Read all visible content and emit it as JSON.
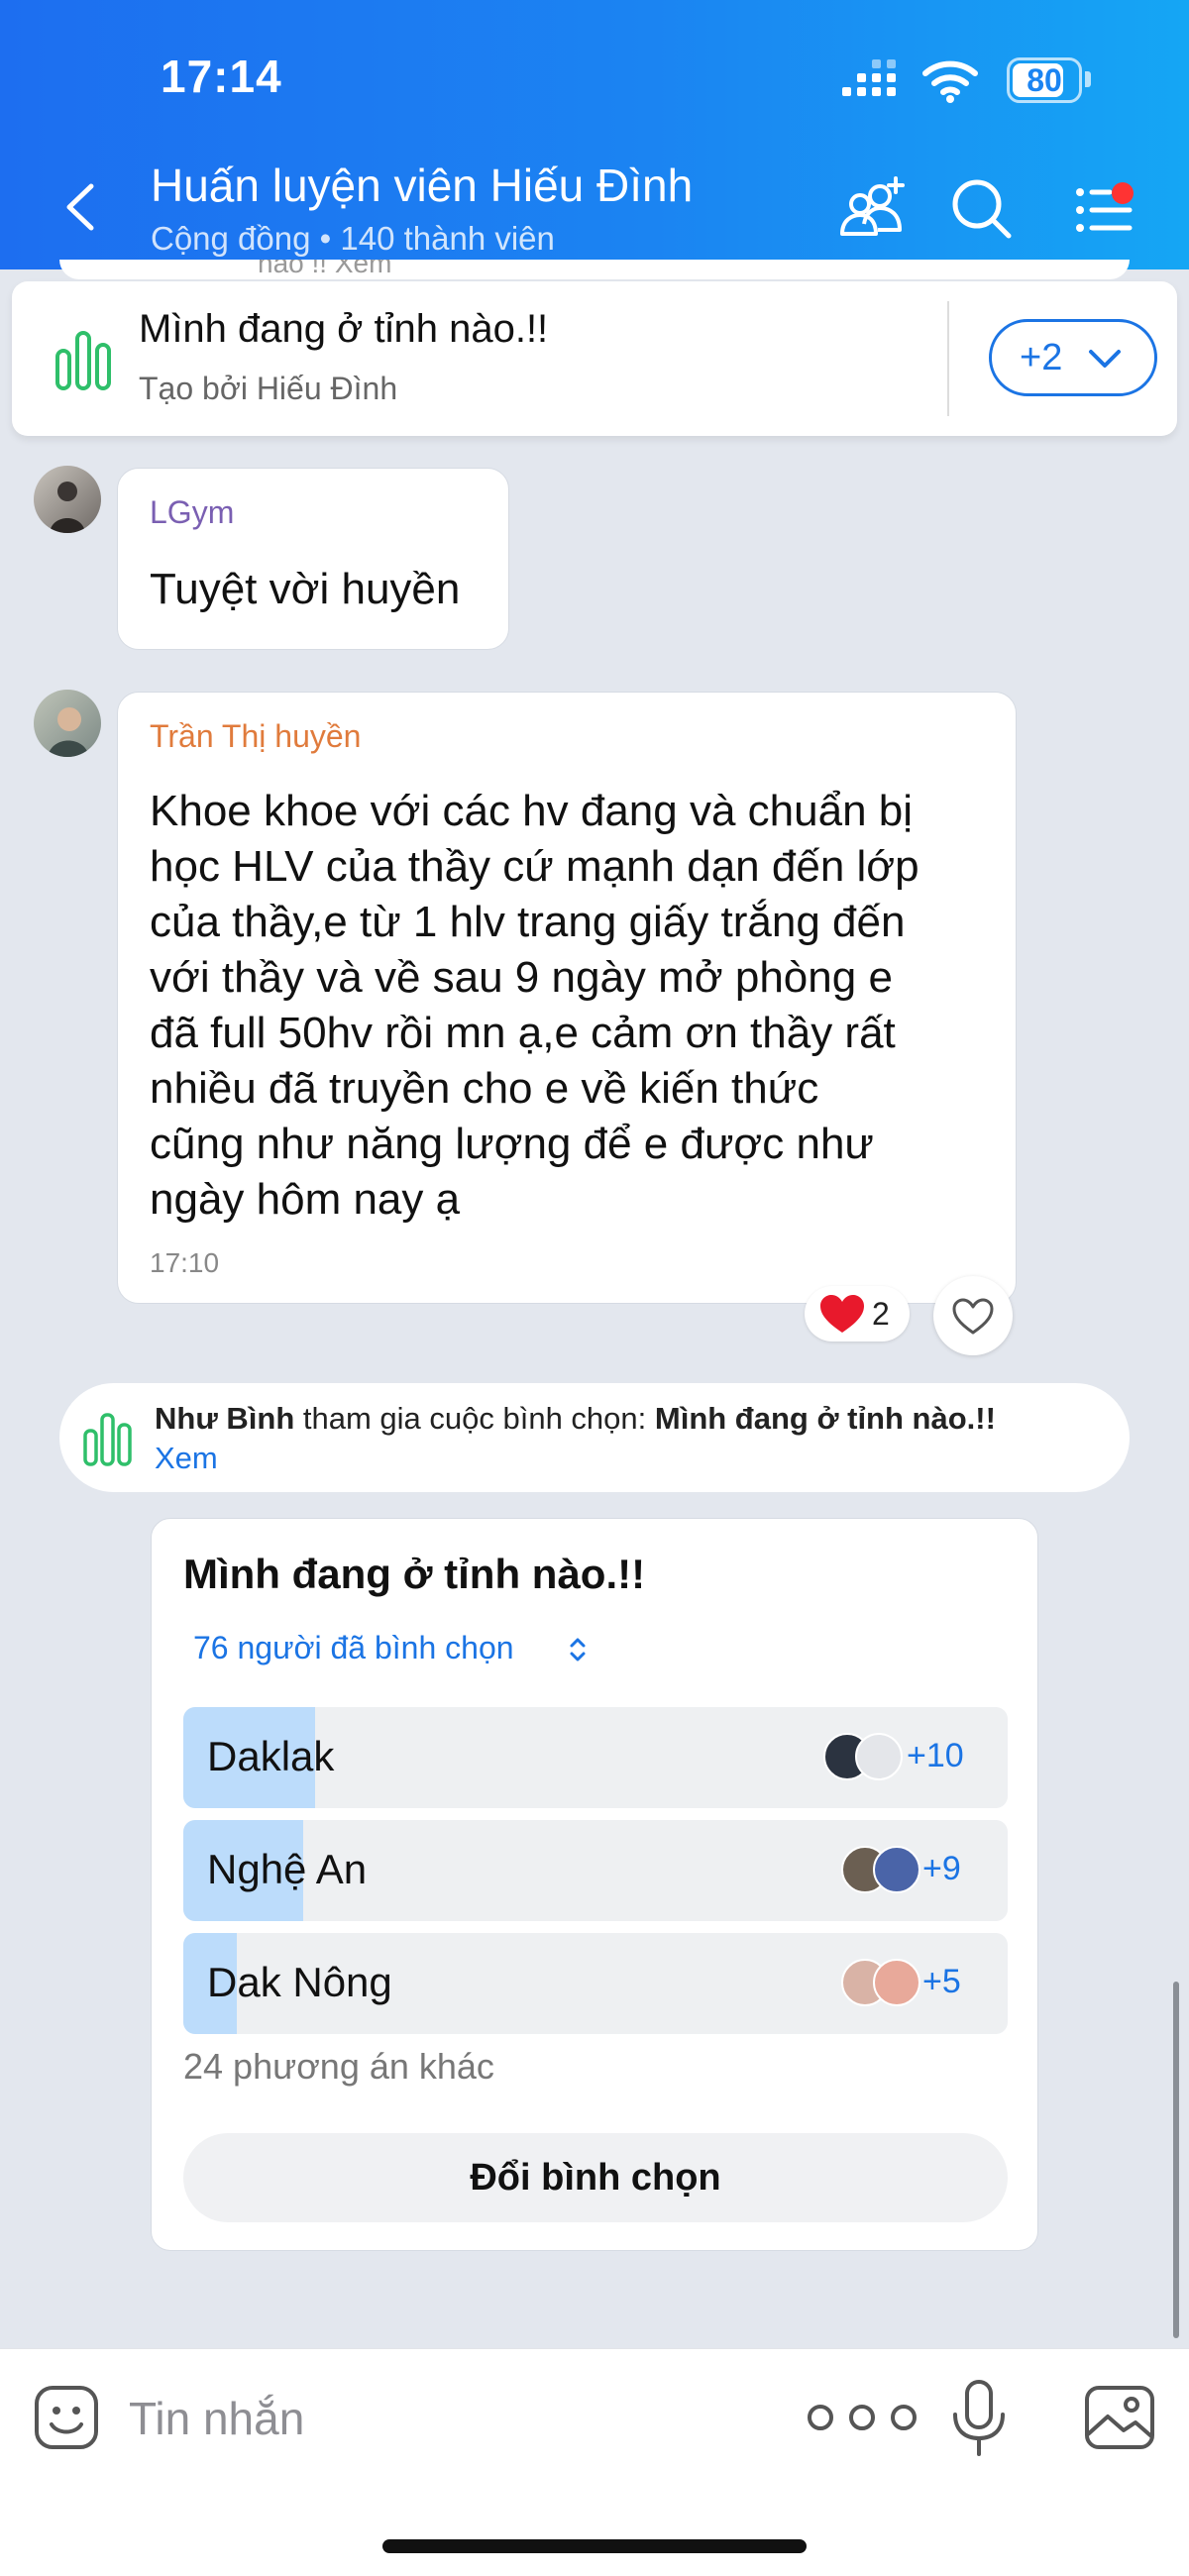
{
  "status_bar": {
    "time": "17:14",
    "battery_level": 80,
    "battery_label": "80"
  },
  "header": {
    "title": "Huấn luyện viên Hiếu Đình",
    "subtitle": "Cộng đồng • 140 thành viên",
    "icons": [
      "back-icon",
      "add-member-icon",
      "search-icon",
      "menu-icon"
    ],
    "peek_text": "nào !! Xem"
  },
  "pinned_poll": {
    "title": "Mình đang ở tỉnh nào.!!",
    "created_by": "Tạo bởi Hiếu Đình",
    "more_label": "+2"
  },
  "messages": [
    {
      "sender": "LGym",
      "sender_color": "#7a5fb2",
      "text": "Tuyệt vời huyền"
    },
    {
      "sender": "Trần Thị huyền",
      "sender_color": "#e07b3c",
      "text_lines": [
        "Khoe khoe với các hv đang và chuẩn bị",
        "học HLV của thầy cứ mạnh dạn đến lớp",
        "của thầy,e từ 1 hlv trang giấy trắng đến",
        "với thầy và về sau 9 ngày mở phòng e",
        "đã full 50hv rồi mn ạ,e cảm ơn thầy rất",
        "nhiều đã truyền cho e về kiến thức",
        "cũng như năng lượng để e được như",
        "ngày hôm nay ạ"
      ],
      "time": "17:10",
      "reaction_count": "2"
    }
  ],
  "notice": {
    "actor": "Như Bình",
    "action": " tham gia cuộc bình chọn: ",
    "poll_title": "Mình đang ở tỉnh nào.!!",
    "link": "Xem"
  },
  "poll": {
    "title": "Mình đang ở tỉnh nào.!!",
    "voters_label": "76 người đã bình chọn",
    "options": [
      {
        "label": "Daklak",
        "fill": 0.16,
        "more": "+10"
      },
      {
        "label": "Nghệ An",
        "fill": 0.145,
        "more": "+9"
      },
      {
        "label": "Dak Nông",
        "fill": 0.065,
        "more": "+5"
      }
    ],
    "others_label": "24 phương án khác",
    "change_label": "Đổi bình chọn"
  },
  "composer": {
    "placeholder": "Tin nhắn"
  },
  "colors": {
    "accent": "#1b74e4",
    "header_start": "#1d6ef0",
    "header_end": "#15a6f4",
    "poll_fill": "#bcdcfb",
    "chart_green": "#2fbf6a",
    "heart": "#e8192c"
  }
}
